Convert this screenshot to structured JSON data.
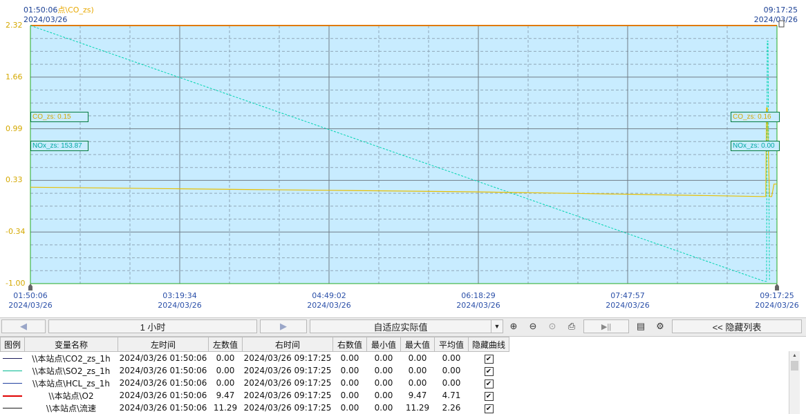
{
  "chart_data": {
    "type": "line",
    "title": "",
    "ylim": [
      -1.0,
      2.32
    ],
    "y_ticks": [
      "2.32",
      "1.66",
      "0.99",
      "0.33",
      "-0.34",
      "-1.00"
    ],
    "x_ticks": [
      {
        "time": "01:50:06",
        "date": "2024/03/26"
      },
      {
        "time": "03:19:34",
        "date": "2024/03/26"
      },
      {
        "time": "04:49:02",
        "date": "2024/03/26"
      },
      {
        "time": "06:18:29",
        "date": "2024/03/26"
      },
      {
        "time": "07:47:57",
        "date": "2024/03/26"
      },
      {
        "time": "09:17:25",
        "date": "2024/03/26"
      }
    ],
    "top_left": {
      "time": "01:50:06",
      "date": "2024/03/26",
      "series_label": "点\\CO_zs)"
    },
    "top_right": {
      "time": "09:17:25",
      "date": "2024/03/26"
    },
    "markers": [
      {
        "text": "CO_zs: 0.15"
      },
      {
        "text": "NOx_zs: 153.87"
      },
      {
        "text": "CO_zs: 0.16"
      },
      {
        "text": "NOx_zs: 0.00"
      }
    ],
    "series": [
      {
        "color": "#00d4b0",
        "style": "dashed",
        "x": [
          0,
          0.983,
          0.986,
          0.987,
          0.988,
          0.99
        ],
        "values": [
          2.32,
          -0.97,
          -0.97,
          2.12,
          2.12,
          -0.97
        ]
      },
      {
        "color": "#e8c000",
        "style": "solid",
        "x": [
          0,
          0.2,
          0.4,
          0.6,
          0.8,
          0.98,
          0.985,
          0.986,
          0.987,
          0.99,
          0.993,
          0.996,
          1.0
        ],
        "values": [
          0.24,
          0.22,
          0.2,
          0.18,
          0.15,
          0.12,
          0.12,
          1.26,
          1.26,
          0.12,
          0.12,
          0.28,
          0.28
        ]
      }
    ]
  },
  "toolbar": {
    "prev_arrow": "◀",
    "time_span": "1  小时",
    "next_arrow": "▶",
    "scale_mode": "自适应实际值",
    "dropdown_arrow": "▼",
    "zoom_in": "⊕",
    "zoom_out": "⊖",
    "zoom_reset": "⊙",
    "print": "⎙",
    "play": "▶||",
    "export": "▤",
    "settings": "⚙",
    "hide_list": "<<  隐藏列表"
  },
  "table": {
    "headers": [
      "图例",
      "变量名称",
      "左时间",
      "左数值",
      "右时间",
      "右数值",
      "最小值",
      "最大值",
      "平均值",
      "隐藏曲线"
    ],
    "rows": [
      {
        "color": "#1a1a5a",
        "name": "\\\\本站点\\CO2_zs_1h",
        "left_time": "2024/03/26 01:50:06",
        "left_val": "0.00",
        "right_time": "2024/03/26 09:17:25",
        "right_val": "0.00",
        "min": "0.00",
        "max": "0.00",
        "avg": "0.00",
        "hidden_mark": "✔"
      },
      {
        "color": "#00b890",
        "name": "\\\\本站点\\SO2_zs_1h",
        "left_time": "2024/03/26 01:50:06",
        "left_val": "0.00",
        "right_time": "2024/03/26 09:17:25",
        "right_val": "0.00",
        "min": "0.00",
        "max": "0.00",
        "avg": "0.00",
        "hidden_mark": "✔"
      },
      {
        "color": "#2040a0",
        "name": "\\\\本站点\\HCL_zs_1h",
        "left_time": "2024/03/26 01:50:06",
        "left_val": "0.00",
        "right_time": "2024/03/26 09:17:25",
        "right_val": "0.00",
        "min": "0.00",
        "max": "0.00",
        "avg": "0.00",
        "hidden_mark": "✔"
      },
      {
        "color": "#e00000",
        "name": "\\\\本站点\\O2",
        "left_time": "2024/03/26 01:50:06",
        "left_val": "9.47",
        "right_time": "2024/03/26 09:17:25",
        "right_val": "0.00",
        "min": "0.00",
        "max": "9.47",
        "avg": "4.71",
        "hidden_mark": "✔"
      },
      {
        "color": "#1a1a1a",
        "name": "\\\\本站点\\流速",
        "left_time": "2024/03/26 01:50:06",
        "left_val": "11.29",
        "right_time": "2024/03/26 09:17:25",
        "right_val": "0.00",
        "min": "0.00",
        "max": "11.29",
        "avg": "2.26",
        "hidden_mark": "✔"
      }
    ]
  }
}
